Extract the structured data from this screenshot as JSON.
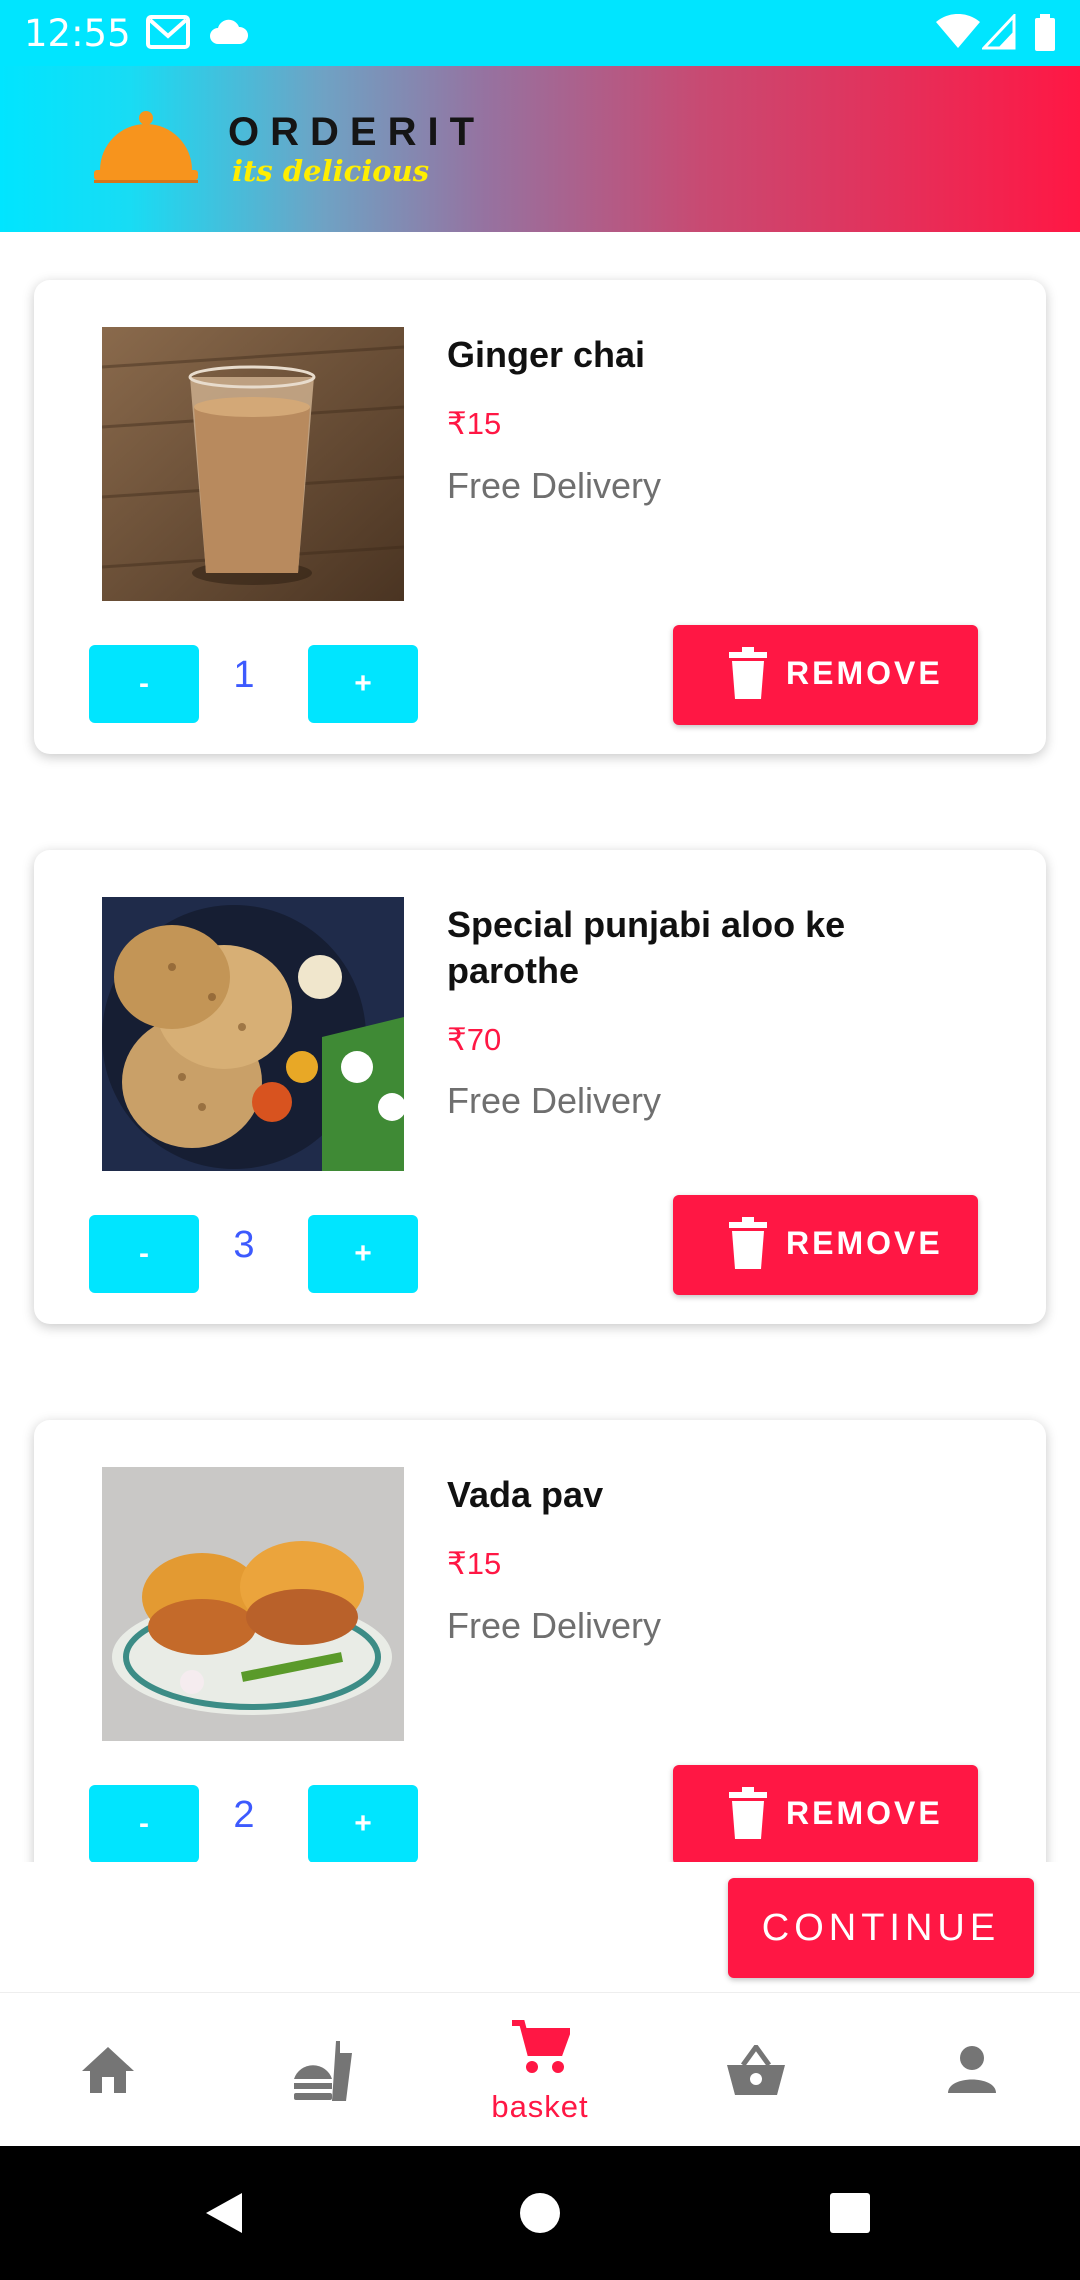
{
  "status_bar": {
    "time": "12:55",
    "icons": [
      "gmail-icon",
      "cloud-icon",
      "wifi-icon",
      "cell-signal-icon",
      "battery-icon"
    ]
  },
  "header": {
    "logo_icon": "cloche-icon",
    "brand": "ORDERIT",
    "tagline": "its delicious"
  },
  "cart": {
    "items": [
      {
        "name": "Ginger chai",
        "price": "₹15",
        "delivery": "Free Delivery",
        "quantity": "1",
        "minus_label": "-",
        "plus_label": "+",
        "remove_label": "REMOVE",
        "image": "chai-photo"
      },
      {
        "name": "Special punjabi aloo ke parothe",
        "price": "₹70",
        "delivery": "Free Delivery",
        "quantity": "3",
        "minus_label": "-",
        "plus_label": "+",
        "remove_label": "REMOVE",
        "image": "paratha-photo"
      },
      {
        "name": "Vada pav",
        "price": "₹15",
        "delivery": "Free Delivery",
        "quantity": "2",
        "minus_label": "-",
        "plus_label": "+",
        "remove_label": "REMOVE",
        "image": "vada-pav-photo"
      }
    ]
  },
  "continue_label": "CONTINUE",
  "bottom_nav": {
    "items": [
      {
        "icon": "home-icon",
        "label": ""
      },
      {
        "icon": "food-icon",
        "label": ""
      },
      {
        "icon": "cart-icon",
        "label": "basket",
        "active": true
      },
      {
        "icon": "basket-icon",
        "label": ""
      },
      {
        "icon": "person-icon",
        "label": ""
      }
    ]
  },
  "colors": {
    "accent": "#ff1744",
    "cyan": "#00e5ff",
    "quantity_text": "#3d5afe",
    "inactive_icon": "#757575"
  }
}
